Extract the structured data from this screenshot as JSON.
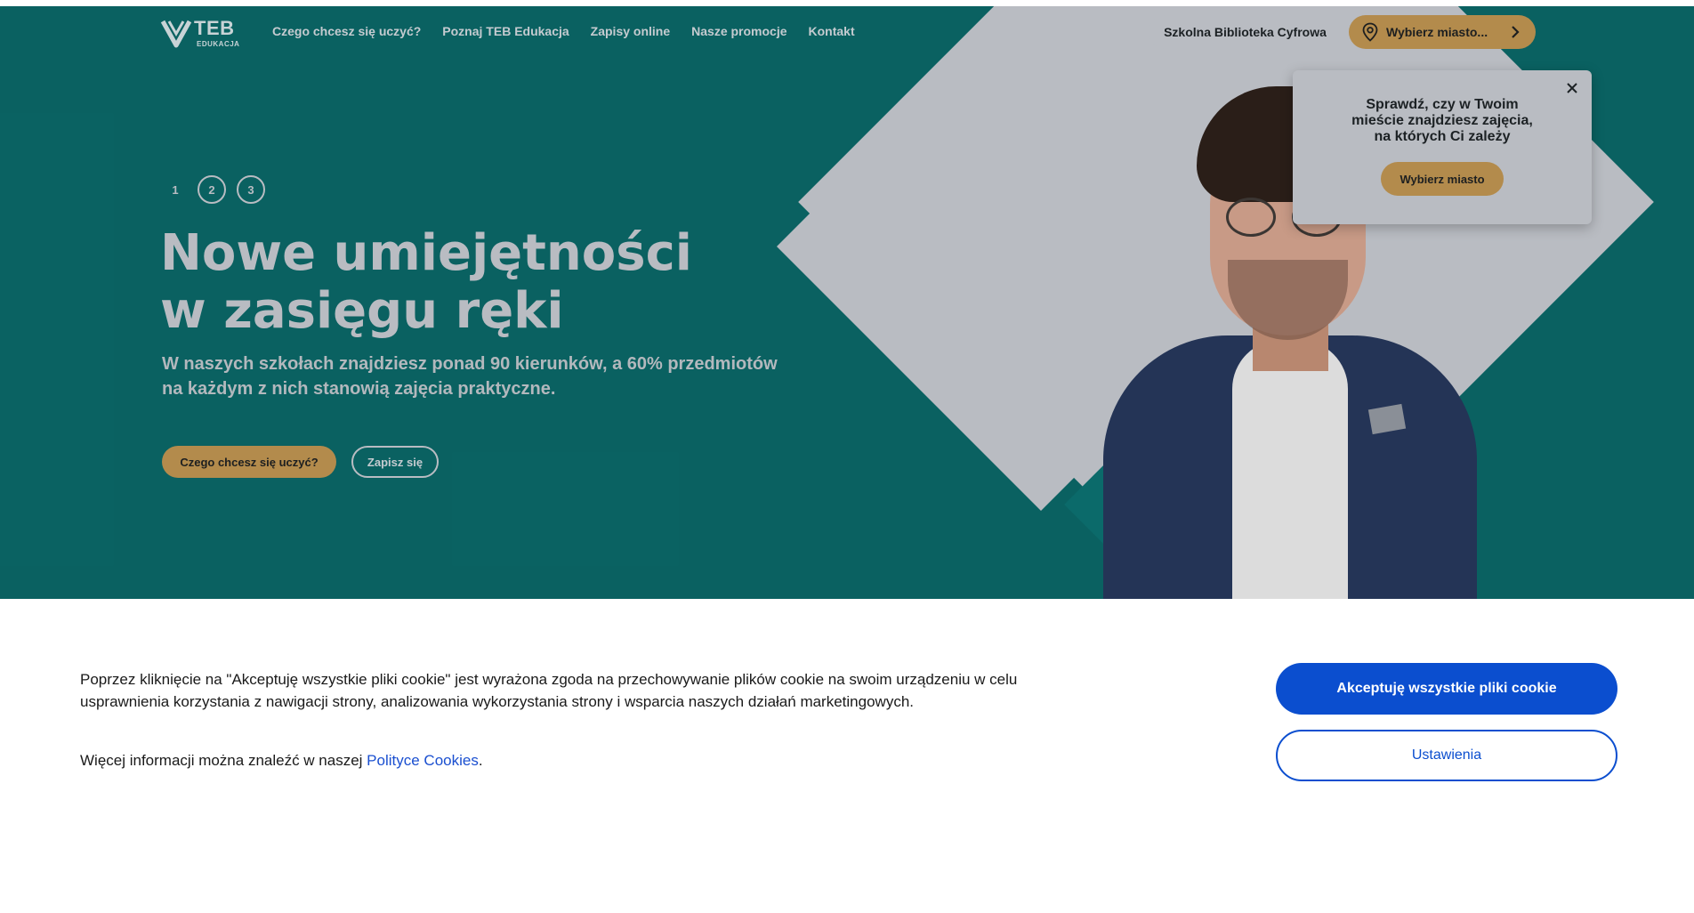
{
  "header": {
    "logo_text": "TEB",
    "logo_sub": "EDUKACJA",
    "nav": [
      {
        "label": "Czego chcesz się uczyć?"
      },
      {
        "label": "Poznaj TEB Edukacja"
      },
      {
        "label": "Zapisy online"
      },
      {
        "label": "Nasze promocje"
      },
      {
        "label": "Kontakt"
      }
    ],
    "library_label": "Szkolna Biblioteka Cyfrowa",
    "city_label": "Wybierz miasto..."
  },
  "hero": {
    "slides": [
      "1",
      "2",
      "3"
    ],
    "title_line1": "Nowe umiejętności",
    "title_line2": "w zasięgu ręki",
    "subtitle_line1": "W naszych szkołach znajdziesz ponad 90 kierunków, a 60% przedmiotów",
    "subtitle_line2": "na każdym z nich stanowią zajęcia praktyczne.",
    "btn_learn": "Czego chcesz się uczyć?",
    "btn_signup": "Zapisz się"
  },
  "city_popup": {
    "line1": "Sprawdź, czy w Twoim",
    "line2": "mieście znajdziesz zajęcia,",
    "line3": "na których Ci zależy",
    "button": "Wybierz miasto"
  },
  "cookie": {
    "text": "Poprzez kliknięcie na \"Akceptuję wszystkie pliki cookie\" jest wyrażona zgoda na przechowywanie plików cookie na swoim urządzeniu w celu usprawnienia korzystania z nawigacji strony, analizowania wykorzystania strony i wsparcia naszych działań marketingowych.",
    "more_prefix": "Więcej informacji można znaleźć w naszej ",
    "link_label": "Polityce Cookies",
    "more_suffix": ".",
    "accept_label": "Akceptuję wszystkie pliki cookie",
    "settings_label": "Ustawienia"
  },
  "colors": {
    "hero_bg": "#0b6a6a",
    "accent_gold": "#b38b4c",
    "light_grey": "#b9bcc2",
    "cookie_blue": "#0b4ecf"
  },
  "icons": {
    "logo": "teb-logo-icon",
    "pin": "map-pin-icon",
    "chevron": "chevron-right-icon",
    "close": "close-icon"
  }
}
